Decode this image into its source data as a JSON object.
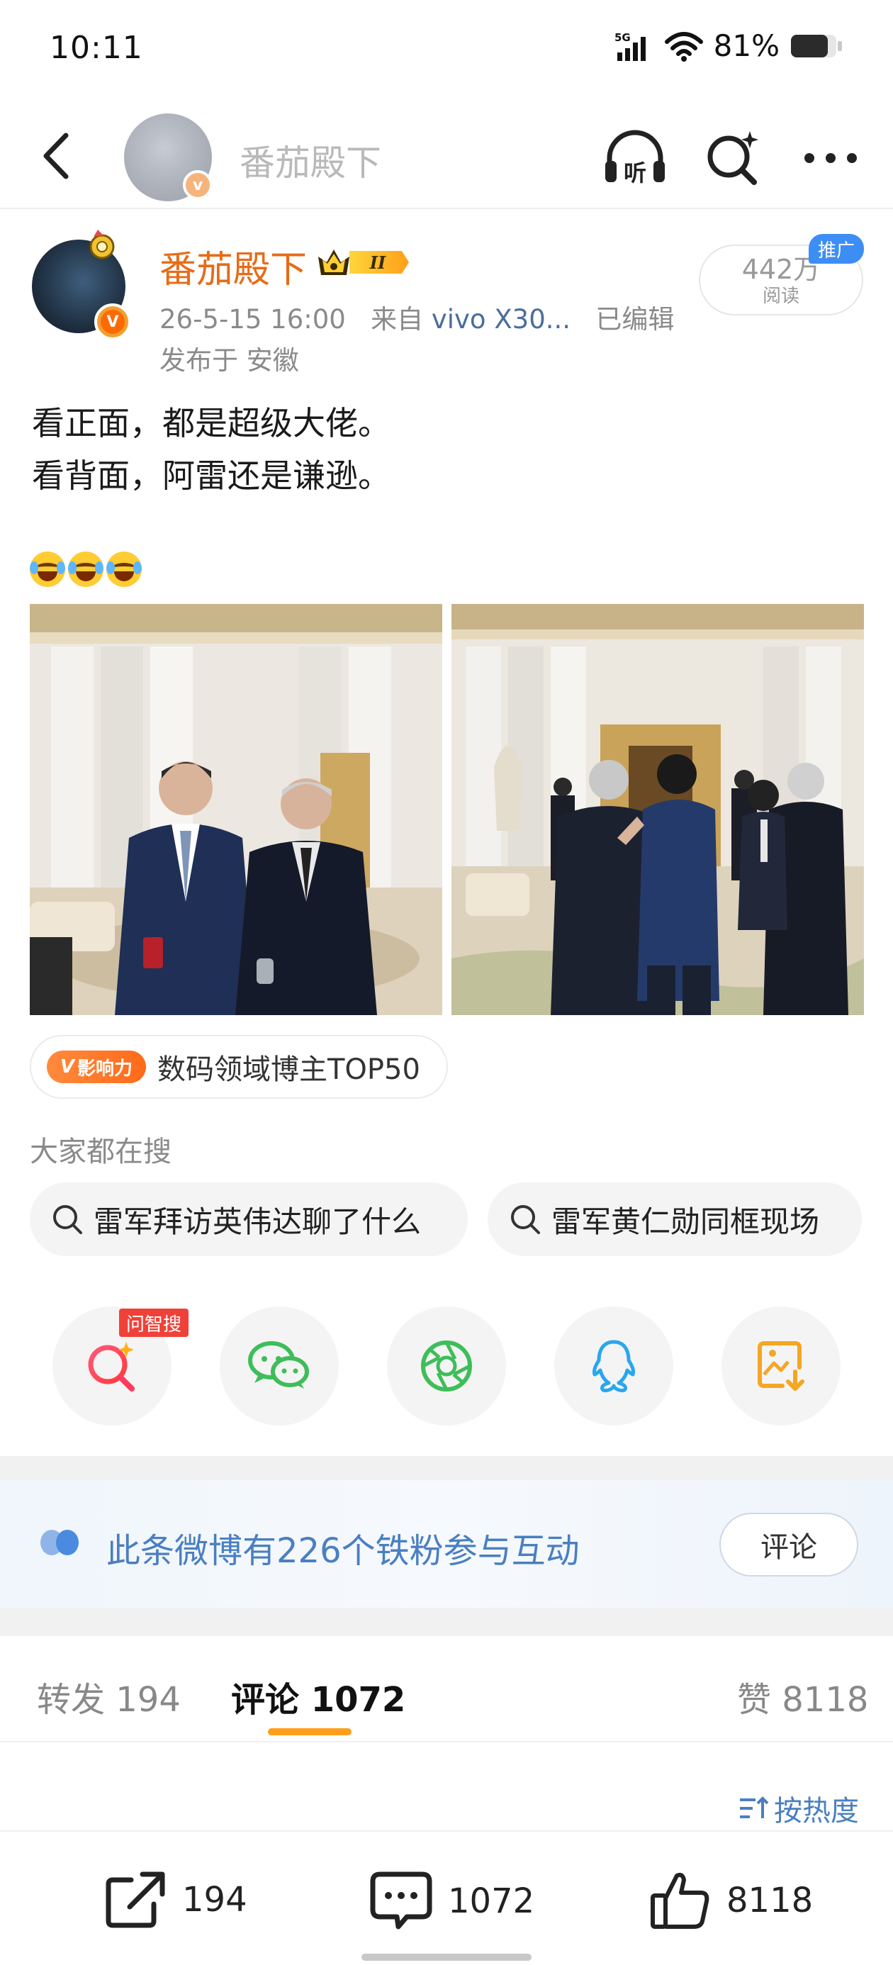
{
  "status_bar": {
    "time": "10:11",
    "network": "5G",
    "battery": "81%"
  },
  "nav": {
    "title": "番茄殿下",
    "icons": [
      "back-icon",
      "listen-icon",
      "search-sparkle-icon",
      "more-icon"
    ],
    "listen_label": "听"
  },
  "post": {
    "author": "番茄殿下",
    "vip_level": "II",
    "time": "26-5-15 16:00",
    "source_prefix": "来自",
    "device": "vivo X30...",
    "edited": "已编辑",
    "location": "发布于 安徽",
    "reads_count": "442万",
    "reads_label": "阅读",
    "promo_tag": "推广",
    "text_lines": [
      "看正面，都是超级大佬。",
      "看背面，阿雷还是谦逊。"
    ],
    "emoji_count": 3,
    "images": [
      "photo-front",
      "photo-back"
    ]
  },
  "influence": {
    "badge": "影响力",
    "badge_v": "V",
    "text": "数码领域博主TOP50"
  },
  "search": {
    "heading": "大家都在搜",
    "chips": [
      "雷军拜访英伟达聊了什么",
      "雷军黄仁勋同框现场"
    ]
  },
  "share": {
    "ask_tag": "问智搜",
    "items": [
      "ask-search-icon",
      "wechat-icon",
      "moments-icon",
      "qq-icon",
      "save-image-icon"
    ]
  },
  "fans_banner": {
    "text": "此条微博有226个铁粉参与互动",
    "button": "评论"
  },
  "tabs": {
    "repost": "转发 194",
    "comments": "评论 1072",
    "likes": "赞 8118"
  },
  "sort": {
    "label": "按热度"
  },
  "bottom_bar": {
    "share_count": "194",
    "comment_count": "1072",
    "like_count": "8118"
  },
  "colors": {
    "accent_orange": "#e86b16",
    "link_blue": "#4a7fc1",
    "tab_underline": "#ff9e1b",
    "promo_blue": "#3d8ef4"
  }
}
